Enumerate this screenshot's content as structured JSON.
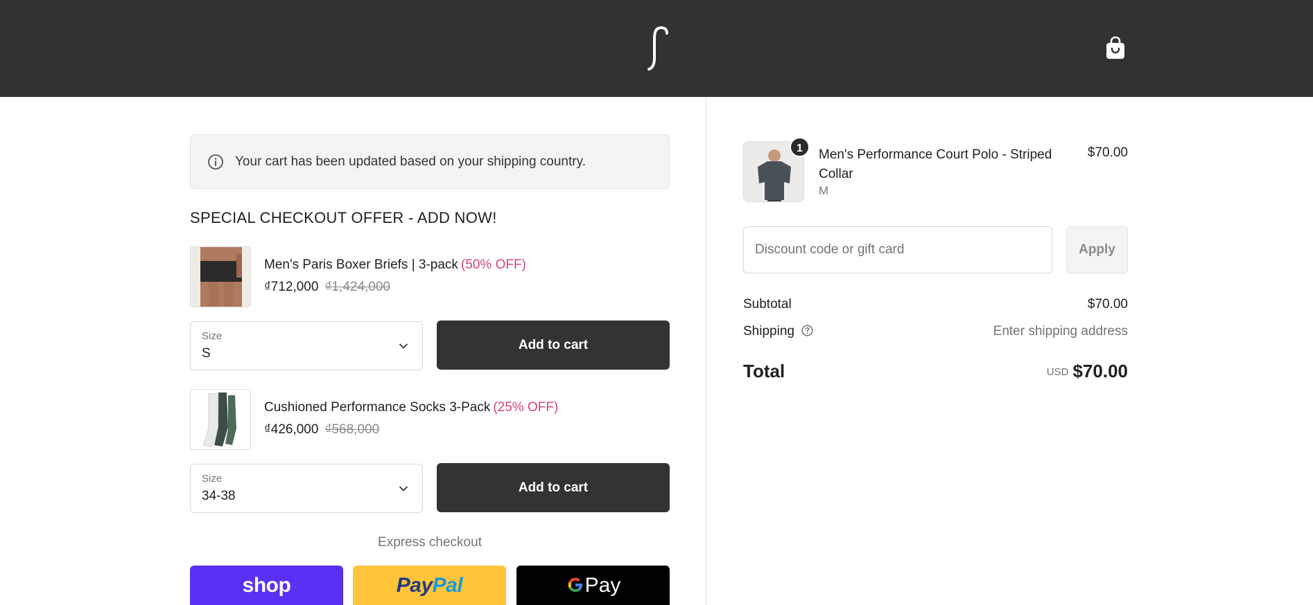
{
  "header": {
    "logo": "logo-mark",
    "cart_icon": "shopping-bag-icon"
  },
  "notice": {
    "text": "Your cart has been updated based on your shipping country."
  },
  "offer": {
    "title": "SPECIAL CHECKOUT OFFER - ADD NOW!",
    "items": [
      {
        "name": "Men's Paris Boxer Briefs | 3-pack",
        "discount": "(50% OFF)",
        "price": "₫712,000",
        "compare_price": "₫1,424,000",
        "size_label": "Size",
        "size_value": "S",
        "button": "Add to cart"
      },
      {
        "name": "Cushioned Performance Socks 3-Pack",
        "discount": "(25% OFF)",
        "price": "₫426,000",
        "compare_price": "₫568,000",
        "size_label": "Size",
        "size_value": "34-38",
        "button": "Add to cart"
      }
    ]
  },
  "express": {
    "label": "Express checkout",
    "buttons": {
      "shop": "shop",
      "paypal_1": "Pay",
      "paypal_2": "Pal",
      "gpay": "Pay"
    }
  },
  "order": {
    "item": {
      "quantity": "1",
      "name": "Men's Performance Court Polo - Striped Collar",
      "variant": "M",
      "price": "$70.00"
    },
    "discount_placeholder": "Discount code or gift card",
    "apply": "Apply",
    "subtotal_label": "Subtotal",
    "subtotal_value": "$70.00",
    "shipping_label": "Shipping",
    "shipping_value": "Enter shipping address",
    "total_label": "Total",
    "total_currency": "USD",
    "total_value": "$70.00"
  },
  "colors": {
    "header_bg": "#323232",
    "discount_pink": "#d8417a",
    "shop_purple": "#5a31f4",
    "paypal_yellow": "#ffc439",
    "button_dark": "#333333"
  }
}
